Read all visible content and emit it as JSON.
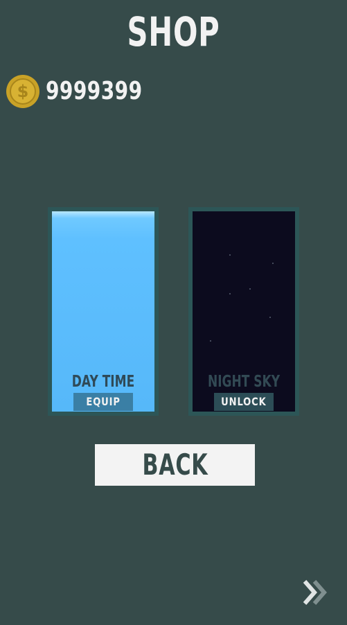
{
  "header": {
    "title": "SHOP"
  },
  "wallet": {
    "icon": "coin-icon",
    "coin_symbol": "$",
    "coins": "9999399",
    "coin_color": "#c9a227"
  },
  "skins": [
    {
      "name": "DAY TIME",
      "action": "EQUIP",
      "equipped": true,
      "color": "#5fc0ff"
    },
    {
      "name": "NIGHT SKY",
      "action": "UNLOCK",
      "equipped": false,
      "color": "#0c0b1e"
    }
  ],
  "footer": {
    "back_label": "BACK",
    "next_icon": "double-chevron-right-icon"
  },
  "colors": {
    "background": "#364b4a",
    "card_border": "#2c5657",
    "text_light": "#f2f2f2"
  }
}
